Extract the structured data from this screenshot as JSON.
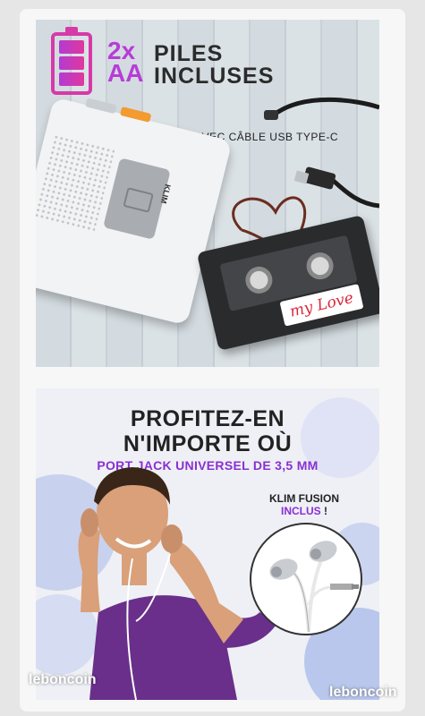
{
  "panel1": {
    "headline_big": [
      "2x",
      "AA"
    ],
    "headline_small": [
      "PILES",
      "INCLUSES"
    ],
    "cable_caption": "AVEC CÂBLE USB TYPE-C",
    "player_brand": "KLIM",
    "cassette_sticker": "my Love"
  },
  "panel2": {
    "title_line1": "PROFITEZ-EN",
    "title_line2": "N'IMPORTE OÙ",
    "subtitle": "PORT JACK UNIVERSEL DE 3,5 MM",
    "earphones_name": "KLIM FUSION",
    "earphones_included": "INCLUS",
    "earphones_bang": " !"
  },
  "watermarks": {
    "left": "leboncoin",
    "right": "leboncoin"
  },
  "colors": {
    "accent_purple": "#8a2fd3",
    "accent_pink": "#d63aa9",
    "orange_button": "#f39a30"
  }
}
